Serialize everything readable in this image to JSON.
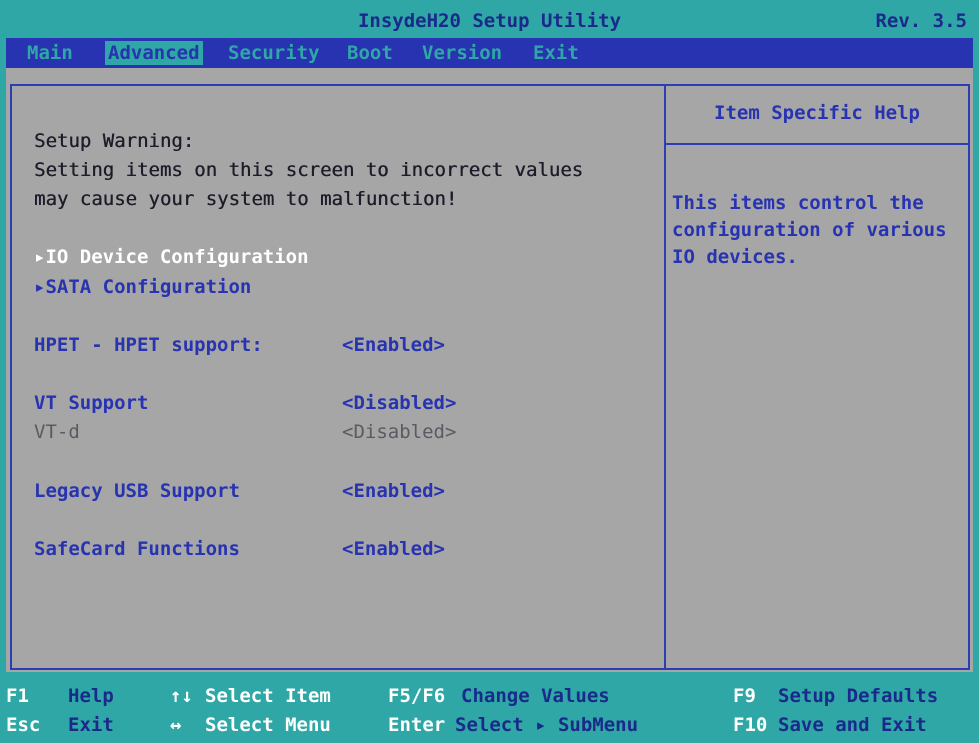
{
  "title": "InsydeH20 Setup Utility",
  "revision": "Rev. 3.5",
  "menu": {
    "items": [
      "Main",
      "Advanced",
      "Security",
      "Boot",
      "Version",
      "Exit"
    ],
    "active_index": 1
  },
  "warning": {
    "line1": "Setup Warning:",
    "line2": "Setting items on this screen to incorrect values",
    "line3": "may cause your system to malfunction!"
  },
  "submenus": [
    {
      "label": "▸IO Device Configuration",
      "selected": true
    },
    {
      "label": "▸SATA Configuration",
      "selected": false
    }
  ],
  "settings": [
    {
      "label": "HPET - HPET support:",
      "value": "<Enabled>",
      "enabled": true
    },
    {
      "label": "VT Support",
      "value": "<Disabled>",
      "enabled": true
    },
    {
      "label": "VT-d",
      "value": "<Disabled>",
      "enabled": false
    },
    {
      "label": "Legacy USB Support",
      "value": "<Enabled>",
      "enabled": true
    },
    {
      "label": "SafeCard Functions",
      "value": "<Enabled>",
      "enabled": true
    }
  ],
  "help": {
    "title": "Item Specific Help",
    "text": "This items control the\nconfiguration of various\nIO devices."
  },
  "footer": {
    "f1_key": "F1",
    "f1_desc": "Help",
    "esc_key": "Esc",
    "esc_desc": "Exit",
    "updown_key": "↑↓",
    "updown_desc": "Select Item",
    "leftright_key": "↔",
    "leftright_desc": "Select Menu",
    "f5f6_key": "F5/F6",
    "f5f6_desc": "Change Values",
    "enter_key": "Enter",
    "enter_desc": "Select ▸ SubMenu",
    "f9_key": "F9",
    "f9_desc": "Setup Defaults",
    "f10_key": "F10",
    "f10_desc": "Save and Exit"
  },
  "colors": {
    "cyan": "#2fa7a6",
    "blue": "#2733b0",
    "panel_gray": "#a6a6a6",
    "selected_white": "#ffffff"
  }
}
